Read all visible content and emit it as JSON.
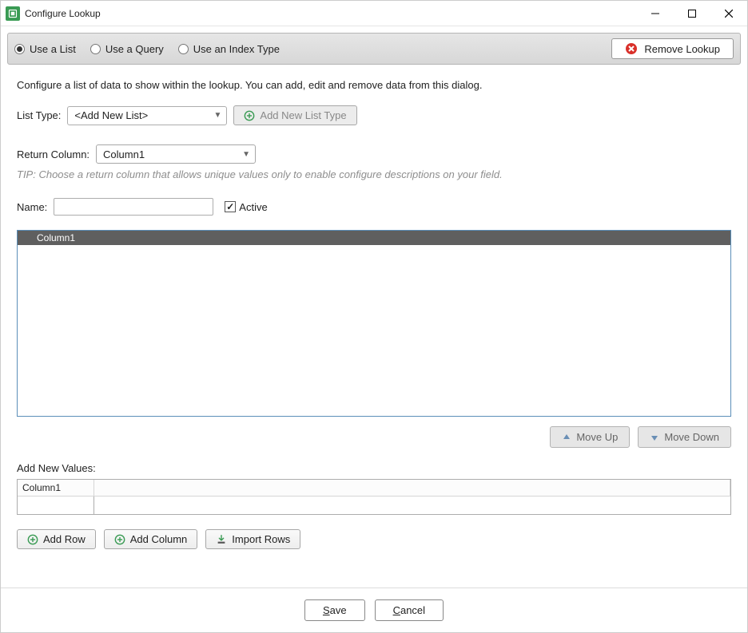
{
  "window": {
    "title": "Configure Lookup"
  },
  "modebar": {
    "options": [
      "Use a List",
      "Use a Query",
      "Use an Index Type"
    ],
    "selected": 0,
    "remove_label": "Remove Lookup"
  },
  "description": "Configure a list of data to show within the lookup. You can add, edit and remove data from this dialog.",
  "listtype": {
    "label": "List Type:",
    "value": "<Add New List>",
    "add_button": "Add New List Type"
  },
  "return_col": {
    "label": "Return Column:",
    "value": "Column1",
    "tip": "TIP: Choose a return column that allows unique values only to enable configure descriptions on your field."
  },
  "name": {
    "label": "Name:",
    "value": ""
  },
  "active": {
    "label": "Active",
    "checked": true
  },
  "main_table": {
    "columns": [
      "Column1"
    ],
    "rows": []
  },
  "move": {
    "up": "Move Up",
    "down": "Move Down"
  },
  "add_new": {
    "label": "Add New Values:",
    "columns": [
      "Column1"
    ]
  },
  "actions": {
    "add_row": "Add Row",
    "add_column": "Add Column",
    "import_rows": "Import Rows"
  },
  "footer": {
    "save": "Save",
    "cancel": "Cancel"
  }
}
